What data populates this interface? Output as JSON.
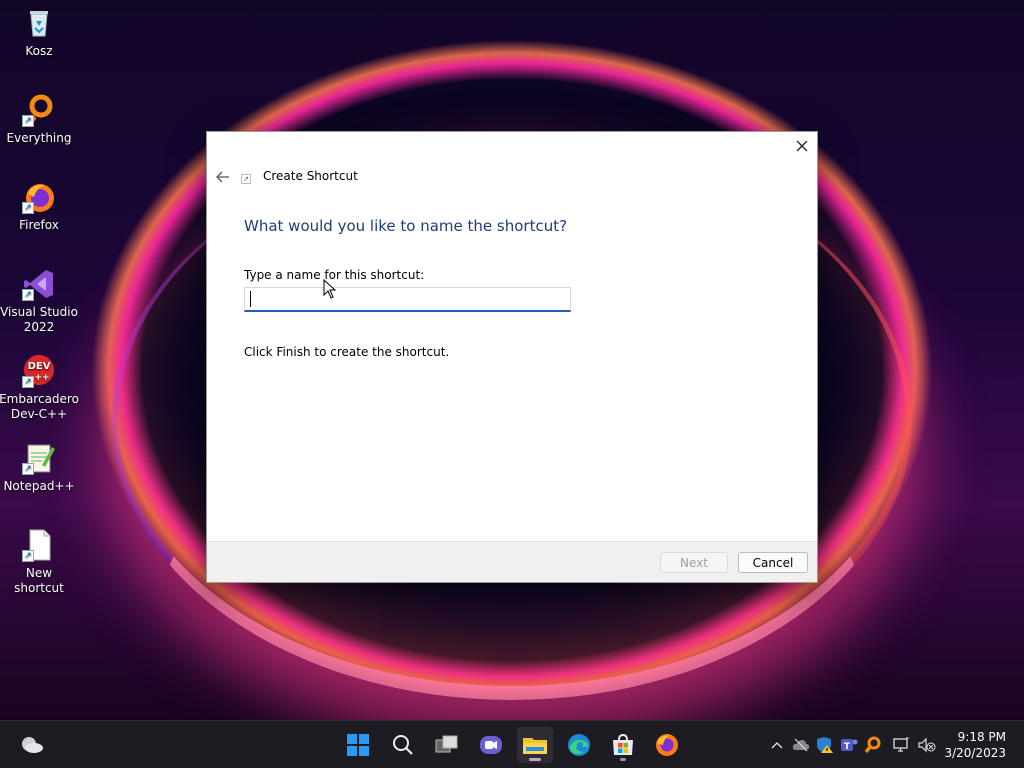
{
  "desktop": {
    "icons": [
      {
        "label": "Kosz",
        "icon": "recycle-bin-icon"
      },
      {
        "label": "Everything",
        "icon": "everything-search-icon"
      },
      {
        "label": "Firefox",
        "icon": "firefox-icon"
      },
      {
        "label": "Visual Studio 2022",
        "icon": "visual-studio-icon"
      },
      {
        "label": "Embarcadero Dev-C++",
        "icon": "devcpp-icon"
      },
      {
        "label": "Notepad++",
        "icon": "notepadpp-icon"
      },
      {
        "label": "New shortcut",
        "icon": "blank-file-shortcut-icon"
      }
    ]
  },
  "dialog": {
    "title": "Create Shortcut",
    "heading": "What would you like to name the shortcut?",
    "field_label": "Type a name for this shortcut:",
    "field_value": "",
    "info": "Click Finish to create the shortcut.",
    "next_label": "Next",
    "cancel_label": "Cancel"
  },
  "taskbar": {
    "apps": [
      "start-icon",
      "search-icon",
      "task-view-icon",
      "teams-chat-icon",
      "file-explorer-icon",
      "edge-icon",
      "store-icon",
      "firefox-icon"
    ],
    "clock": {
      "time": "9:18 PM",
      "date": "3/20/2023"
    }
  },
  "colors": {
    "heading": "#1f3d7a",
    "input_underline": "#1f5fb0",
    "taskbar_bg": "#1c1c22"
  }
}
